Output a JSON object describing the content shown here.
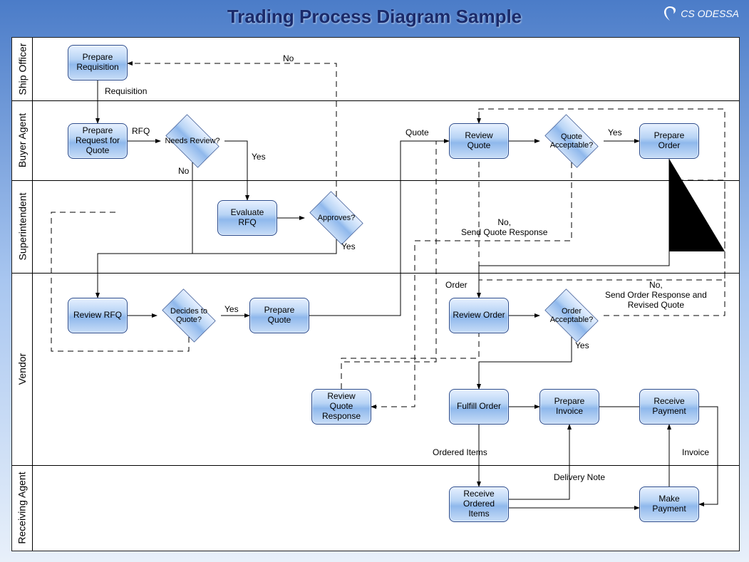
{
  "title": "Trading Process Diagram Sample",
  "logo": "CS ODESSA",
  "lanes": {
    "ship_officer": "Ship Officer",
    "buyer_agent": "Buyer Agent",
    "superintendent": "Superintendent",
    "vendor": "Vendor",
    "receiving_agent": "Receiving Agent"
  },
  "nodes": {
    "prepare_requisition": "Prepare Requisition",
    "prepare_rfq": "Prepare Request for Quote",
    "needs_review": "Needs Review?",
    "evaluate_rfq": "Evaluate RFQ",
    "approves": "Approves?",
    "review_rfq": "Review RFQ",
    "decides_to_quote": "Decides to Quote?",
    "prepare_quote": "Prepare Quote",
    "review_quote_response": "Review Quote Response",
    "review_quote": "Review Quote",
    "quote_acceptable": "Quote Acceptable?",
    "prepare_order": "Prepare Order",
    "review_order": "Review Order",
    "order_acceptable": "Order Acceptable?",
    "fulfill_order": "Fulfill Order",
    "prepare_invoice": "Prepare Invoice",
    "receive_payment": "Receive Payment",
    "receive_ordered_items": "Receive Ordered Items",
    "make_payment": "Make Payment"
  },
  "edge_labels": {
    "requisition": "Requisition",
    "no_top": "No",
    "rfq": "RFQ",
    "needs_review_no": "No",
    "needs_review_yes": "Yes",
    "approves_yes": "Yes",
    "decides_yes": "Yes",
    "quote": "Quote",
    "quote_acceptable_yes": "Yes",
    "quote_acceptable_no": "No,\nSend Quote Response",
    "order": "Order",
    "order_acceptable_yes": "Yes",
    "order_acceptable_no": "No,\nSend Order Response and\nRevised Quote",
    "ordered_items": "Ordered Items",
    "delivery_note": "Delivery Note",
    "invoice": "Invoice"
  }
}
